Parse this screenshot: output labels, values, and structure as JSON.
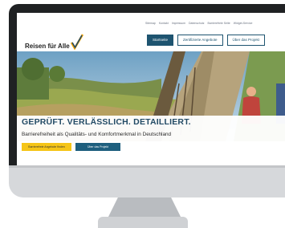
{
  "site": {
    "logo_text": "Reisen für Alle",
    "utility_links": [
      "Sitemap",
      "Kontakt",
      "Impressum",
      "Datenschutz",
      "Barrierefreie Seite",
      "Widget-Service"
    ],
    "nav_buttons": [
      "Startseite",
      "Zertifizierte Angebote",
      "Über das Projekt"
    ],
    "active_nav": "Startseite"
  },
  "banner": {
    "headline": "GEPRÜFT. VERLÄSSLICH. DETAILLIERT.",
    "subline": "Barrierefreiheit als Qualitäts- und Komfortmerkmal in Deutschland",
    "cta_primary": "Barrierefreie Angebote finden",
    "cta_secondary": "Über das Projekt"
  },
  "colors": {
    "brand_blue": "#1e5470",
    "cta_yellow": "#f5c518",
    "headline": "#234b66"
  }
}
